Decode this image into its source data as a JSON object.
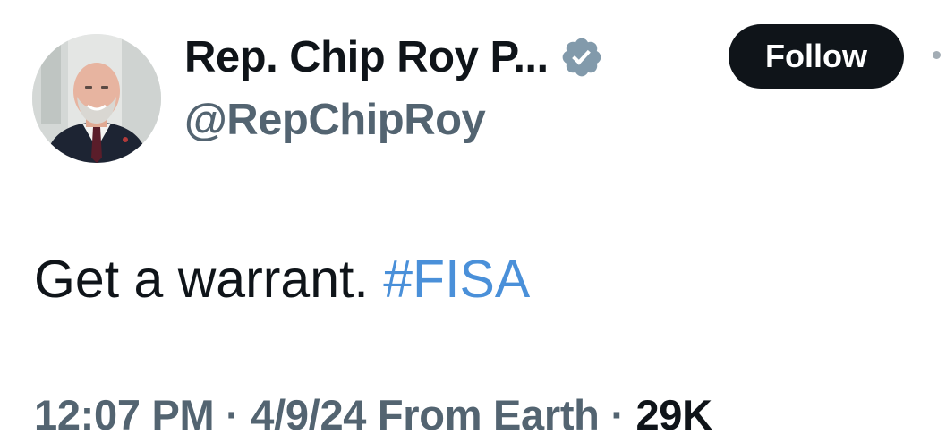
{
  "author": {
    "display_name": "Rep. Chip Roy P...",
    "handle": "@RepChipRoy",
    "verified_icon": "verified-badge-icon",
    "avatar_icon": "profile-photo"
  },
  "actions": {
    "follow_label": "Follow",
    "more_icon": "more-options-icon"
  },
  "tweet": {
    "text": "Get a warrant.",
    "hashtag": "#FISA"
  },
  "meta": {
    "time": "12:07 PM",
    "separator1": " · ",
    "date": "4/9/24",
    "source": "From Earth",
    "separator2": " · ",
    "views": "29K"
  },
  "colors": {
    "hashtag": "#4a90d9",
    "secondary_text": "#536471",
    "primary_text": "#0f1419",
    "follow_bg": "#0f1419",
    "verified_badge": "#829aab"
  }
}
